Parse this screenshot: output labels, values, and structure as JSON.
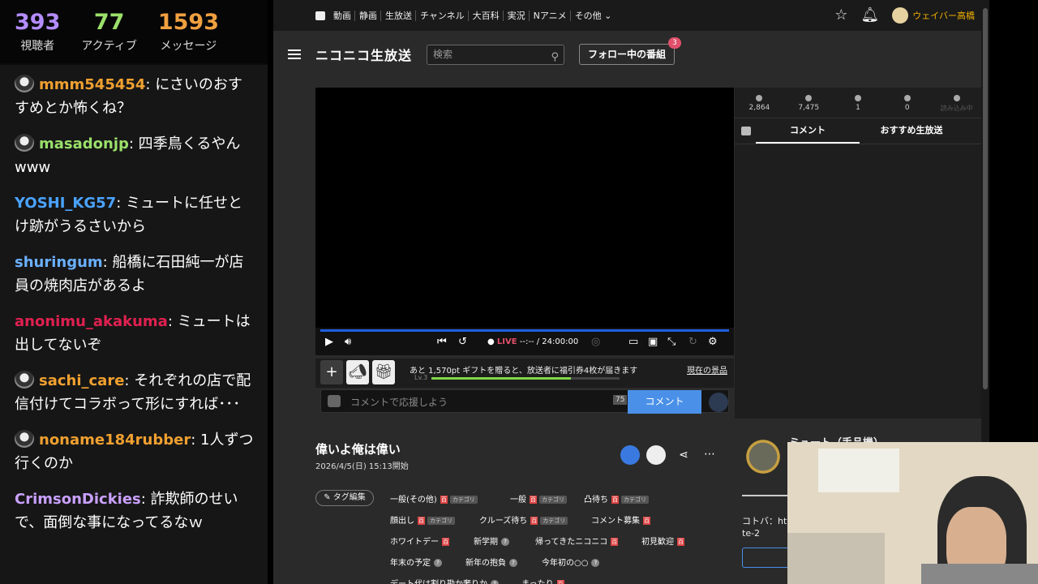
{
  "overlay": {
    "stats": [
      {
        "value": "393",
        "label": "視聴者",
        "color": "#b38cff"
      },
      {
        "value": "77",
        "label": "アクティブ",
        "color": "#9be06b"
      },
      {
        "value": "1593",
        "label": "メッセージ",
        "color": "#f0a040"
      }
    ],
    "messages": [
      {
        "user": "mmm545454",
        "text": ": にさいのおすすめとか怖くね？",
        "color": "#f0a030",
        "avatar": true
      },
      {
        "user": "masadonjp",
        "text": ": 四季鳥くるやんwww",
        "color": "#9be06b",
        "avatar": true
      },
      {
        "user": "YOSHI_KG57",
        "text": ": ミュートに任せとけ跡がうるさいから",
        "color": "#4aa3ff",
        "avatar": false
      },
      {
        "user": "shuringum",
        "text": ": 船橋に石田純一が店員の焼肉店があるよ",
        "color": "#6ab0ff",
        "avatar": false
      },
      {
        "user": "anonimu_akakuma",
        "text": ": ミュートは出してないぞ",
        "color": "#e02050",
        "avatar": false
      },
      {
        "user": "sachi_care",
        "text": ": それぞれの店で配信付けてコラボって形にすれば･･･",
        "color": "#f0a030",
        "avatar": true
      },
      {
        "user": "noname184rubber",
        "text": ": 1人ずつ行くのか",
        "color": "#f0a030",
        "avatar": true
      },
      {
        "user": "CrimsonDickies",
        "text": ": 詐欺師のせいで、面倒な事になってるなｗ",
        "color": "#c9a0ff",
        "avatar": false
      }
    ]
  },
  "topnav": {
    "items": [
      "動画",
      "静画",
      "生放送",
      "チャンネル",
      "大百科",
      "実況",
      "Nアニメ",
      "その他 ⌄"
    ],
    "username": "ウェイバー高橋"
  },
  "header": {
    "logo": "ニコニコ生放送",
    "search_placeholder": "検索",
    "follow_label": "フォロー中の番組",
    "follow_badge": "3"
  },
  "player": {
    "live_label": "LIVE",
    "time": "--:-- / 24:00:00",
    "gift_text": "あと 1,570pt ギフトを贈ると、放送者に福引券4枚が届きます",
    "gift_level": "Lv.3",
    "gift_now": "現在の景品",
    "gift_progress": 0.74,
    "comment_placeholder": "コメントで応援しよう",
    "comment_count": "75",
    "comment_submit": "コメント"
  },
  "side": {
    "stats": [
      "2,864",
      "7,475",
      "1",
      "0",
      "読み込み中"
    ],
    "tabs": [
      "コメント",
      "おすすめ生放送"
    ]
  },
  "program": {
    "title": "偉いよ俺は偉い",
    "date": "2026/4/5(日) 15:13開始",
    "tag_edit": "タグ編集",
    "tags": [
      {
        "label": "一般(その他)",
        "r": true,
        "cat": true
      },
      {
        "label": "一般",
        "r": true,
        "cat": true
      },
      {
        "label": "凸待ち",
        "r": true,
        "cat": true
      },
      {
        "label": "顔出し",
        "r": true,
        "cat": true
      },
      {
        "label": "クルーズ待ち",
        "r": true,
        "cat": true
      },
      {
        "label": "コメント募集",
        "r": true,
        "cat": false
      },
      {
        "label": "ホワイトデー",
        "r": true,
        "cat": false
      },
      {
        "label": "新学期",
        "r": false,
        "cat": false
      },
      {
        "label": "帰ってきたニコニコ",
        "r": true,
        "cat": false
      },
      {
        "label": "初見歓迎",
        "r": true,
        "cat": false
      },
      {
        "label": "年末の予定",
        "r": false,
        "cat": false
      },
      {
        "label": "新年の抱負",
        "r": false,
        "cat": false
      },
      {
        "label": "今年初の○○",
        "r": false,
        "cat": false
      },
      {
        "label": "デート代は割り勘か奢りか",
        "r": false,
        "cat": false
      },
      {
        "label": "まったり",
        "r": true,
        "cat": false
      }
    ],
    "streamer": "ミュート（手品機）",
    "bio_lines": [
      "コトバ：ht",
      "te-2"
    ]
  }
}
